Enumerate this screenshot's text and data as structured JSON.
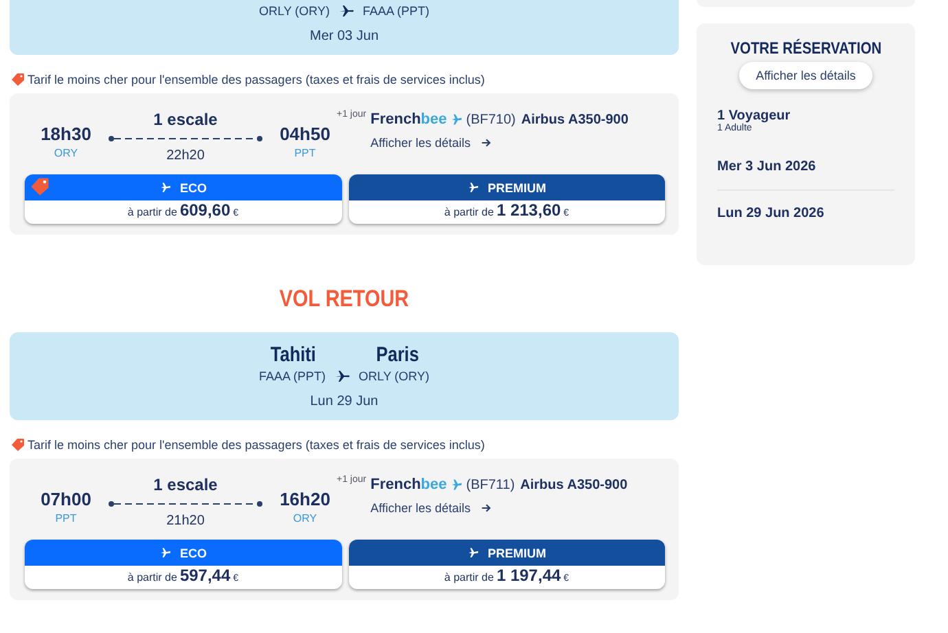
{
  "outbound": {
    "banner": {
      "from_airport": "ORLY (ORY)",
      "to_airport": "FAAA (PPT)",
      "date": "Mer 03 Jun"
    },
    "notice": "Tarif le moins cher pour l'ensemble des passagers (taxes et frais de services inclus)",
    "flight": {
      "departure_time": "18h30",
      "departure_code": "ORY",
      "stops": "1 escale",
      "duration": "22h20",
      "arrival_time": "04h50",
      "arrival_code": "PPT",
      "day_offset": "+1 jour",
      "airline": [
        "French",
        "bee"
      ],
      "flight_number": "(BF710)",
      "aircraft": "Airbus A350-900",
      "details_link": "Afficher les détails",
      "fares": [
        {
          "kind": "eco",
          "name": "ECO",
          "prefix": "à partir de",
          "price": "609,60",
          "currency": "€",
          "cheapest": true
        },
        {
          "kind": "premium",
          "name": "PREMIUM",
          "prefix": "à partir de",
          "price": "1 213,60",
          "currency": "€",
          "cheapest": false
        }
      ]
    }
  },
  "return": {
    "heading": "VOL RETOUR",
    "banner": {
      "from_city": "Tahiti",
      "to_city": "Paris",
      "from_airport": "FAAA (PPT)",
      "to_airport": "ORLY (ORY)",
      "date": "Lun 29 Jun"
    },
    "notice": "Tarif le moins cher pour l'ensemble des passagers (taxes et frais de services inclus)",
    "flight": {
      "departure_time": "07h00",
      "departure_code": "PPT",
      "stops": "1 escale",
      "duration": "21h20",
      "arrival_time": "16h20",
      "arrival_code": "ORY",
      "day_offset": "+1 jour",
      "airline": [
        "French",
        "bee"
      ],
      "flight_number": "(BF711)",
      "aircraft": "Airbus A350-900",
      "details_link": "Afficher les détails",
      "fares": [
        {
          "kind": "eco",
          "name": "ECO",
          "prefix": "à partir de",
          "price": "597,44",
          "currency": "€",
          "cheapest": false
        },
        {
          "kind": "premium",
          "name": "PREMIUM",
          "prefix": "à partir de",
          "price": "1 197,44",
          "currency": "€",
          "cheapest": false
        }
      ]
    }
  },
  "reservation": {
    "title": "VOTRE RÉSERVATION",
    "details_button": "Afficher les détails",
    "travelers": "1 Voyageur",
    "travelers_detail": "1 Adulte",
    "dates": [
      "Mer 3 Jun 2026",
      "Lun 29 Jun 2026"
    ]
  }
}
